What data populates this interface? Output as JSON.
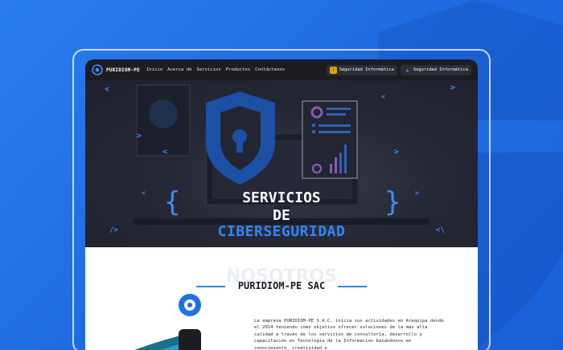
{
  "nav": {
    "brand": "PURIDIOM-PE",
    "links": [
      "Inicio",
      "Acerca de",
      "Servicios",
      "Productos",
      "Contáctenos"
    ],
    "buttons": [
      {
        "label": "Seguridad Informática",
        "icon": "warning-icon",
        "color": "#e0a300"
      },
      {
        "label": "Seguridad Informática",
        "icon": "alert-triangle-icon",
        "color": "#2f86ff"
      }
    ]
  },
  "hero": {
    "line1": "SERVICIOS",
    "line2": "DE",
    "line3": "CIBERSEGURIDAD",
    "accent": "#2f86ff"
  },
  "about": {
    "watermark": "NOSOTROS",
    "title": "PURIDIOM-PE SAC",
    "paragraph": "La empresa PURIDIOM-PE S.A.C. inicia sus actividades en Arequipa desde el 2014 teniendo como objetivo ofrecer soluciones de la más alta calidad a través de los servicios de consultoría, desarrollo y capacitación en Tecnología de la Información basándonos en conocimiento, creatividad e"
  }
}
